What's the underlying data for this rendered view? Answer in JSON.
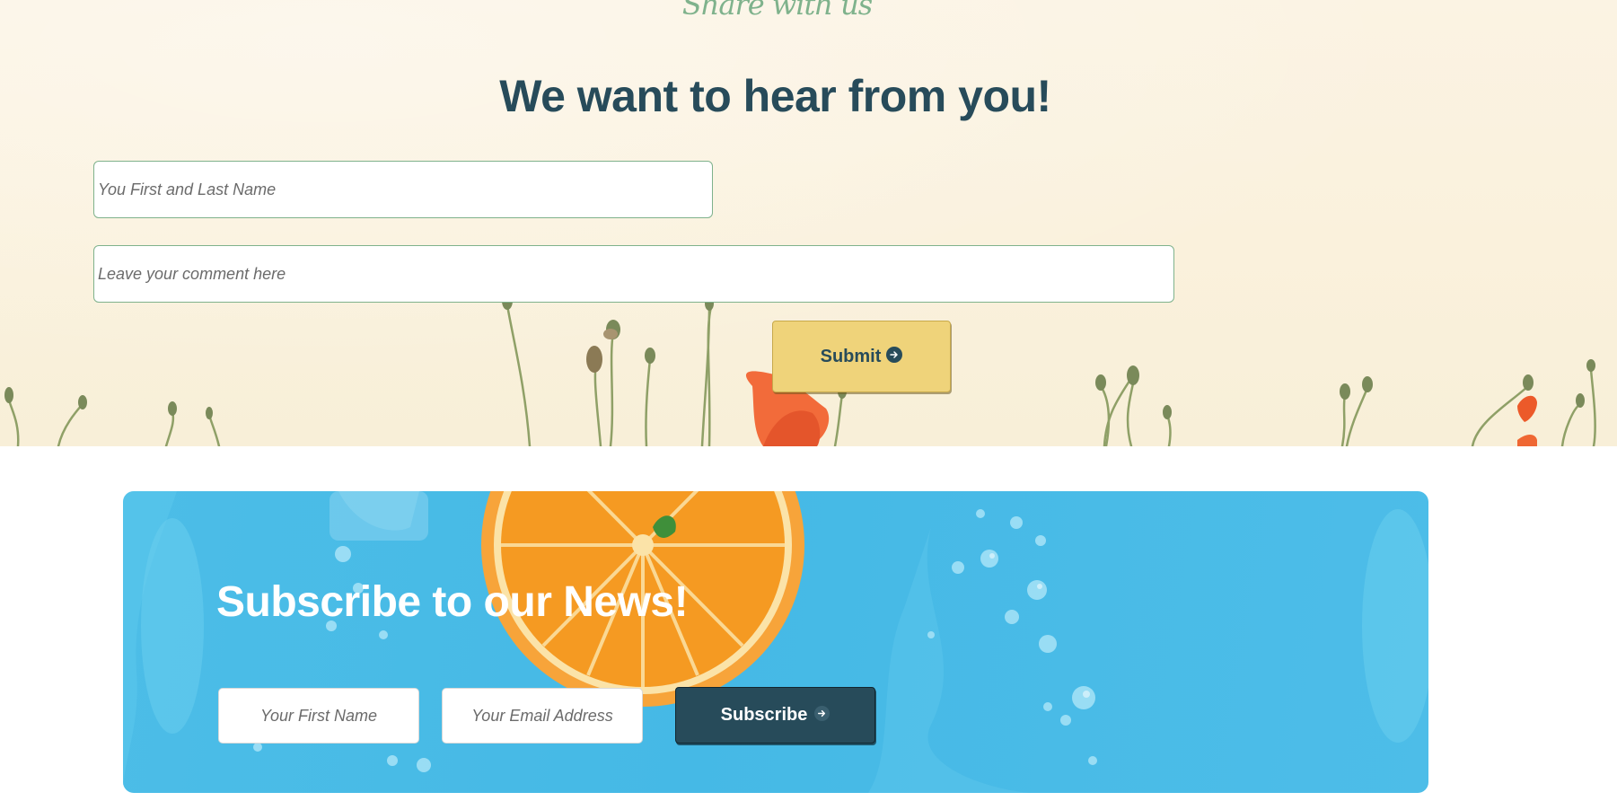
{
  "contact": {
    "eyebrow": "Share with us",
    "title": "We want to hear from you!",
    "name_placeholder": "You First and Last Name",
    "comment_placeholder": "Leave your comment here",
    "submit_label": "Submit",
    "submit_icon": "circle-arrow-right-icon"
  },
  "newsletter": {
    "title": "Subscribe to our News!",
    "first_name_placeholder": "Your First Name",
    "email_placeholder": "Your Email Address",
    "subscribe_label": "Subscribe",
    "subscribe_icon": "circle-arrow-right-icon"
  },
  "colors": {
    "heading": "#274b5a",
    "eyebrow": "#7fb28c",
    "submit_button": "#efd37a",
    "subscribe_button": "#274b5a",
    "newsletter_background": "#4cbde7",
    "contact_background": "#fbf3e3"
  }
}
